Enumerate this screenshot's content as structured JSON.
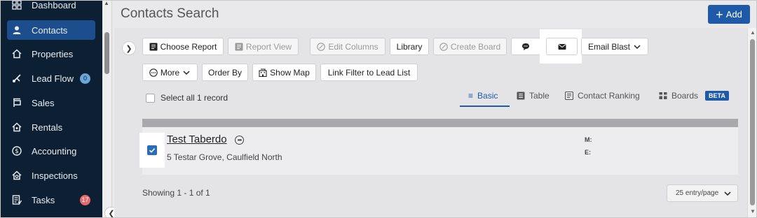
{
  "sidebar": {
    "items": [
      {
        "label": "Dashboard",
        "icon": "grid-icon"
      },
      {
        "label": "Contacts",
        "icon": "user-icon",
        "active": true
      },
      {
        "label": "Properties",
        "icon": "house-icon"
      },
      {
        "label": "Lead Flow",
        "icon": "flow-icon",
        "badge": "0"
      },
      {
        "label": "Sales",
        "icon": "sign-icon"
      },
      {
        "label": "Rentals",
        "icon": "key-house-icon"
      },
      {
        "label": "Accounting",
        "icon": "dollar-icon"
      },
      {
        "label": "Inspections",
        "icon": "search-house-icon"
      },
      {
        "label": "Tasks",
        "icon": "checklist-icon",
        "badge": "17"
      }
    ],
    "background": "#0d1f33",
    "active_color": "#1c4d8c"
  },
  "header": {
    "title": "Contacts Search",
    "add_label": "Add"
  },
  "toolbar": {
    "choose_report": "Choose Report",
    "report_view": "Report View",
    "edit_columns": "Edit Columns",
    "library": "Library",
    "create_board": "Create Board",
    "email_blast": "Email Blast",
    "more": "More",
    "order_by": "Order By",
    "show_map": "Show Map",
    "link_filter": "Link Filter to Lead List"
  },
  "select_all": "Select all 1 record",
  "views": {
    "basic": "Basic",
    "table": "Table",
    "ranking": "Contact Ranking",
    "boards": "Boards",
    "beta": "BETA"
  },
  "record": {
    "name": "Test Taberdo",
    "address": "5 Testar Grove, Caulfield North",
    "m_label": "M:",
    "e_label": "E:",
    "checked": true
  },
  "footer": {
    "showing": "Showing 1 - 1 of 1",
    "per_page": "25 entry/page"
  },
  "colors": {
    "accent": "#1f5aa8",
    "checkbox": "#2b6cb8",
    "badge_blue": "#6aa8dc",
    "badge_red": "#e56b6b"
  }
}
